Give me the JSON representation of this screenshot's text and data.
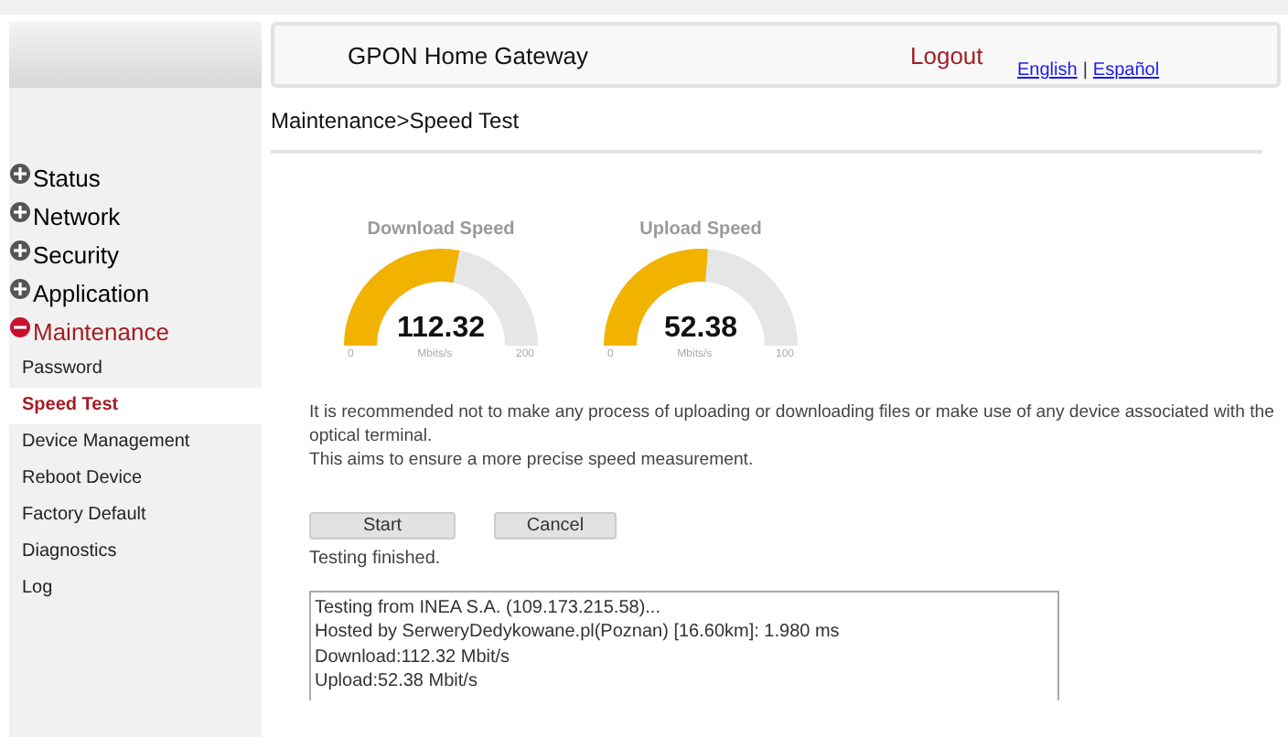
{
  "header": {
    "title": "GPON Home Gateway",
    "logout": "Logout",
    "languages": [
      {
        "label": "English"
      },
      {
        "label": "Español"
      }
    ],
    "language_separator": "|"
  },
  "breadcrumb": "Maintenance>Speed Test",
  "sidebar": {
    "items": [
      {
        "label": "Status",
        "expanded": false
      },
      {
        "label": "Network",
        "expanded": false
      },
      {
        "label": "Security",
        "expanded": false
      },
      {
        "label": "Application",
        "expanded": false
      },
      {
        "label": "Maintenance",
        "expanded": true,
        "children": [
          {
            "label": "Password",
            "selected": false
          },
          {
            "label": "Speed Test",
            "selected": true
          },
          {
            "label": "Device Management",
            "selected": false
          },
          {
            "label": "Reboot Device",
            "selected": false
          },
          {
            "label": "Factory Default",
            "selected": false
          },
          {
            "label": "Diagnostics",
            "selected": false
          },
          {
            "label": "Log",
            "selected": false
          }
        ]
      }
    ]
  },
  "gauges": [
    {
      "title": "Download Speed",
      "value": "112.32",
      "unit": "Mbits/s",
      "min": "0",
      "max": "200",
      "level": 0.5616
    },
    {
      "title": "Upload Speed",
      "value": "52.38",
      "unit": "Mbits/s",
      "min": "0",
      "max": "100",
      "level": 0.5238
    }
  ],
  "notice": [
    "It is recommended not to make any process of uploading or downloading files or make use of any device associated with the optical terminal.",
    "This aims to ensure a more precise speed measurement."
  ],
  "buttons": [
    {
      "label": "Start"
    },
    {
      "label": "Cancel"
    }
  ],
  "status": "Testing finished.",
  "log": [
    "Testing from INEA S.A. (109.173.215.58)...",
    "Hosted by SerweryDedykowane.pl(Poznan) [16.60km]: 1.980 ms",
    "Download:112.32 Mbit/s",
    "Upload:52.38 Mbit/s"
  ]
}
